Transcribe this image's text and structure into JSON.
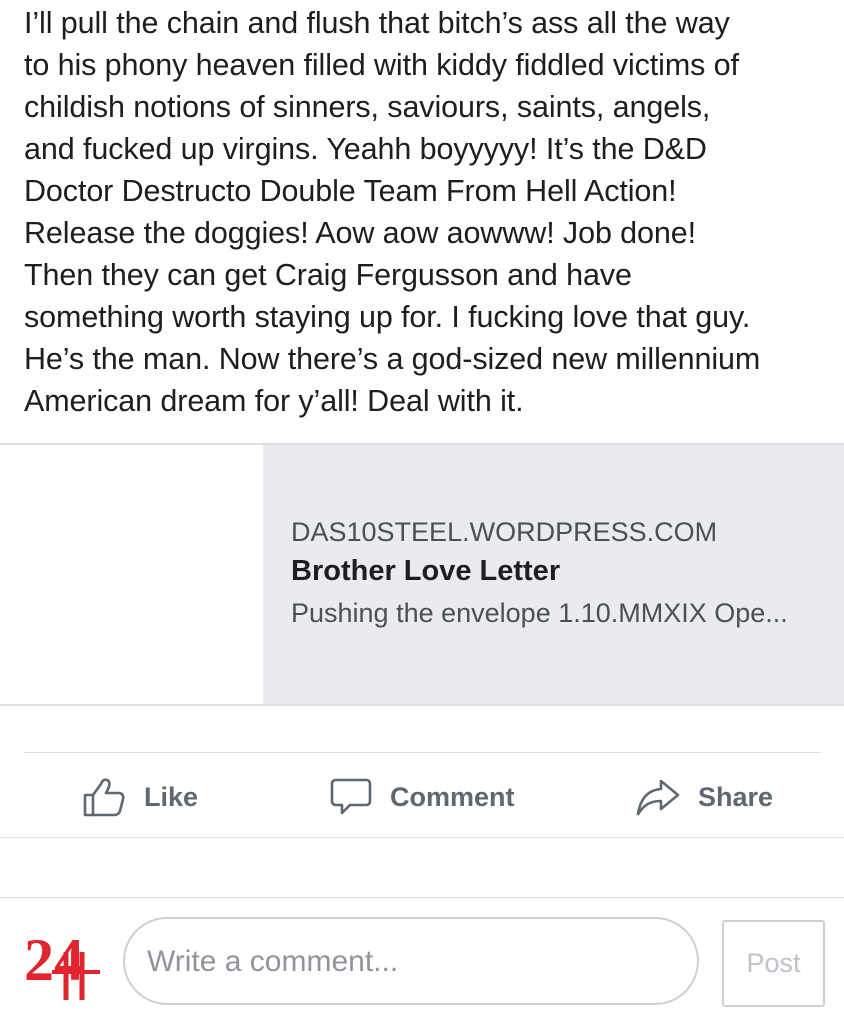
{
  "post": {
    "text_lines": [
      "I’ll pull the chain and flush that bitch’s ass all the way",
      "to his phony heaven filled with kiddy fiddled victims of",
      "childish notions of sinners, saviours, saints, angels,",
      "and fucked up virgins. Yeahh boyyyyy! It’s the D&D",
      "Doctor Destructo Double Team From Hell Action!",
      "Release the doggies! Aow aow aowww! Job done!",
      "Then they can get Craig Fergusson and have",
      "something worth staying up for. I fucking love that guy.",
      "He’s the man. Now there’s a god-sized new millennium",
      "American dream for y’all! Deal with it."
    ]
  },
  "link_preview": {
    "domain": "DAS10STEEL.WORDPRESS.COM",
    "title": "Brother Love Letter",
    "description": "Pushing the envelope 1.10.MMXIX   Ope..."
  },
  "actions": {
    "like_label": "Like",
    "comment_label": "Comment",
    "share_label": "Share",
    "icon_like": "thumbs-up-icon",
    "icon_comment": "speech-bubble-icon",
    "icon_share": "share-arrow-icon"
  },
  "composer": {
    "placeholder": "Write a comment...",
    "post_label": "Post",
    "avatar_text": "24"
  },
  "colors": {
    "text": "#1c1e21",
    "secondary": "#606770",
    "card_bg": "#e9ebee",
    "avatar_red": "#e0252f",
    "divider": "#dddfe2"
  }
}
